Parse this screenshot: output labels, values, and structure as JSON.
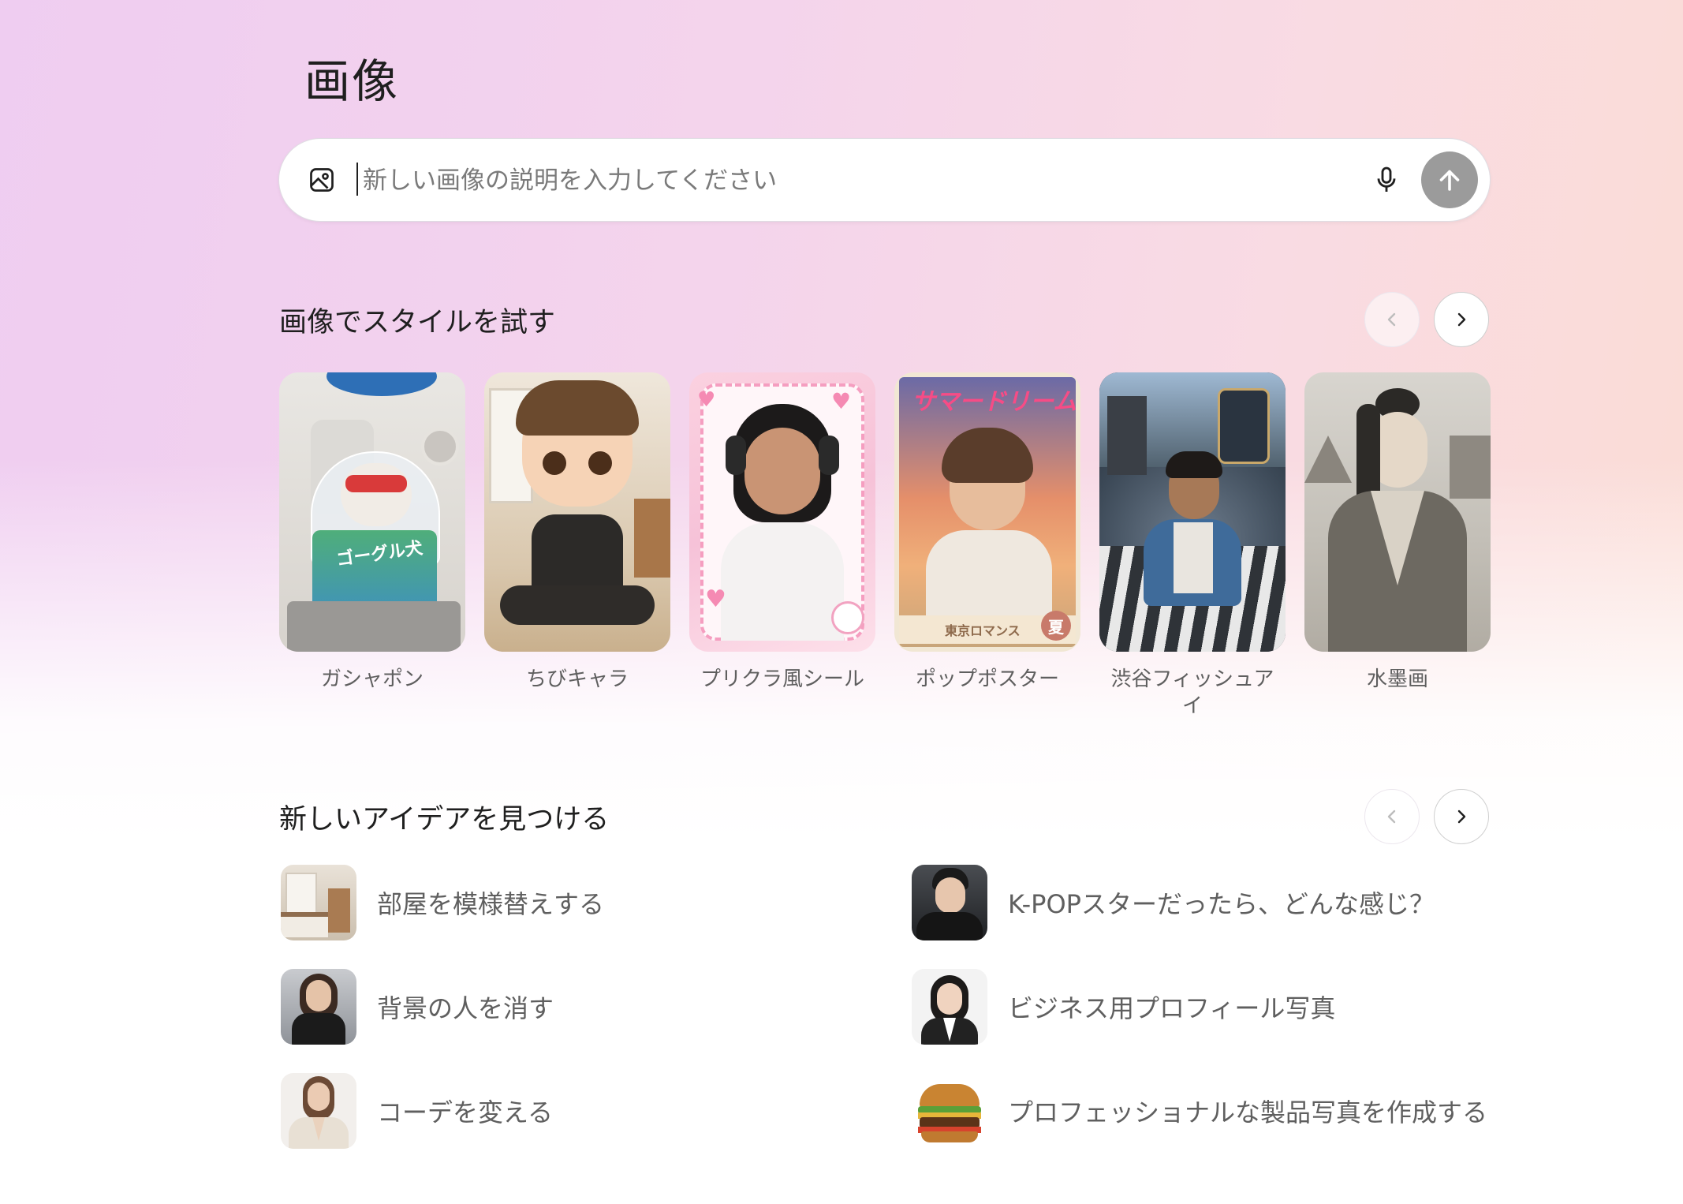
{
  "page": {
    "title": "画像"
  },
  "search": {
    "placeholder": "新しい画像の説明を入力してください"
  },
  "icons": {
    "image": "image-upload-icon",
    "mic": "microphone-icon",
    "send": "arrow-up-icon",
    "prev": "chevron-left-icon",
    "next": "chevron-right-icon"
  },
  "styles": {
    "title": "画像でスタイルを試す",
    "items": [
      {
        "label": "ガシャポン"
      },
      {
        "label": "ちびキャラ"
      },
      {
        "label": "プリクラ風シール"
      },
      {
        "label": "ポップポスター",
        "poster_title": "サマードリーム",
        "poster_footer": "東京ロマンス",
        "poster_badge": "夏"
      },
      {
        "label": "渋谷フィッシュアイ"
      },
      {
        "label": "水墨画"
      }
    ],
    "capsule_text": "ゴーグル犬"
  },
  "ideas": {
    "title": "新しいアイデアを見つける",
    "items": [
      {
        "label": "部屋を模様替えする"
      },
      {
        "label": "K-POPスターだったら、どんな感じ？"
      },
      {
        "label": "背景の人を消す"
      },
      {
        "label": "ビジネス用プロフィール写真"
      },
      {
        "label": "コーデを変える"
      },
      {
        "label": "プロフェッショナルな製品写真を作成する"
      }
    ]
  }
}
